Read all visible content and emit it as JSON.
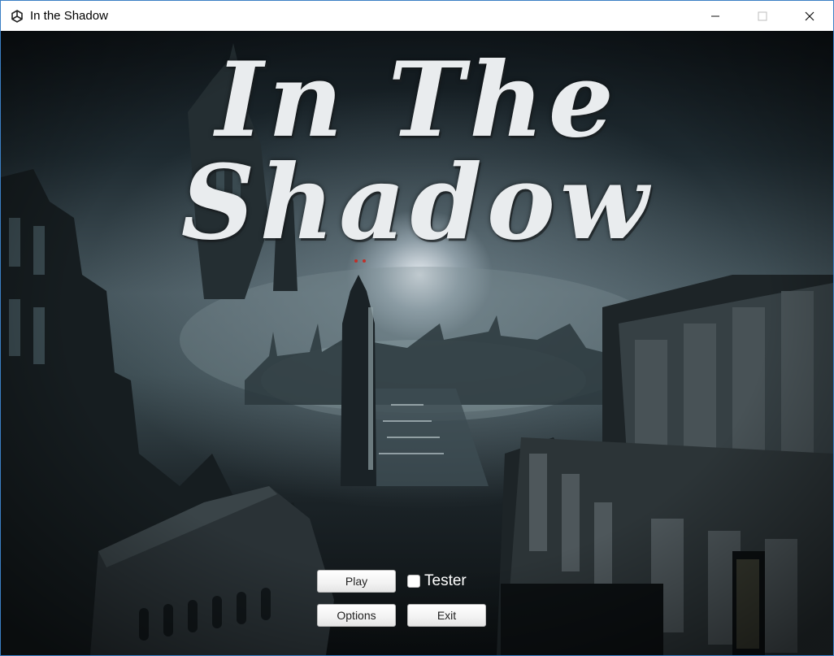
{
  "window": {
    "title": "In the Shadow",
    "app_icon": "unity-icon",
    "controls": [
      "minimize-icon",
      "maximize-icon",
      "close-icon"
    ]
  },
  "game": {
    "title": "In The Shadow"
  },
  "menu": {
    "play_label": "Play",
    "tester_label": "Tester",
    "tester_checked": false,
    "options_label": "Options",
    "exit_label": "Exit"
  },
  "colors": {
    "title_text": "#e9ecee",
    "button_bg": "#f2f2f2",
    "window_border": "#3b7fc4"
  }
}
